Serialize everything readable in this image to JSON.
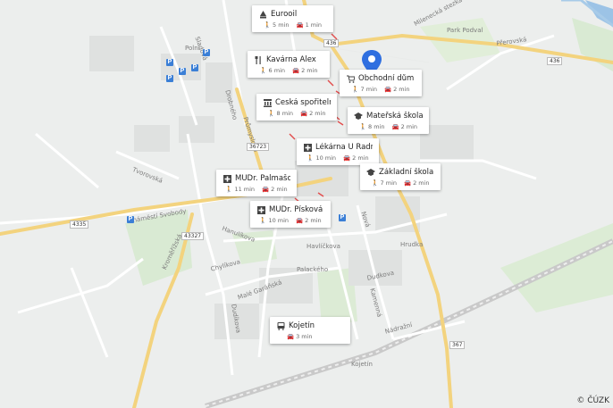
{
  "map": {
    "copyright": "© ČÚZK",
    "street_labels": [
      "Polní",
      "Sladová",
      "Drobného",
      "Průmyslová",
      "Přerovská",
      "Tvorovská",
      "náměstí Svobody",
      "Hanulíkova",
      "Chylíkova",
      "Malé Garáňská",
      "Dudíkova",
      "Dudkova",
      "Havlíčkova",
      "Kamenná",
      "Nádražní",
      "Kojetín",
      "Nová",
      "Hrudka",
      "Park Podval",
      "Milenecká stezka",
      "Kroměřížská",
      "Palackého"
    ],
    "road_numbers": [
      "436",
      "436",
      "36723",
      "4335",
      "43327",
      "367"
    ],
    "marker_color": "#2f6fe0"
  },
  "pois": [
    {
      "name": "Eurooil",
      "icon": "fuel-icon",
      "walk": "5 min",
      "drive": "1 min"
    },
    {
      "name": "Kavárna Alex",
      "icon": "cutlery-icon",
      "walk": "6 min",
      "drive": "2 min"
    },
    {
      "name": "Obchodní dům",
      "icon": "cart-icon",
      "walk": "7 min",
      "drive": "2 min"
    },
    {
      "name": "Česká spořitelna",
      "icon": "bank-icon",
      "walk": "8 min",
      "drive": "2 min"
    },
    {
      "name": "Mateřská škola",
      "icon": "school-icon",
      "walk": "8 min",
      "drive": "2 min"
    },
    {
      "name": "Lékárna U Radnice",
      "icon": "pharmacy-icon",
      "walk": "10 min",
      "drive": "2 min"
    },
    {
      "name": "MUDr. Palmašová...",
      "icon": "medical-icon",
      "walk": "11 min",
      "drive": "2 min"
    },
    {
      "name": "Základní škola Ko...",
      "icon": "school-icon",
      "walk": "7 min",
      "drive": "2 min"
    },
    {
      "name": "MUDr. Písková M...",
      "icon": "medical-icon",
      "walk": "10 min",
      "drive": "2 min"
    },
    {
      "name": "Kojetín",
      "icon": "bus-icon",
      "walk": "",
      "drive": "3 min"
    }
  ]
}
